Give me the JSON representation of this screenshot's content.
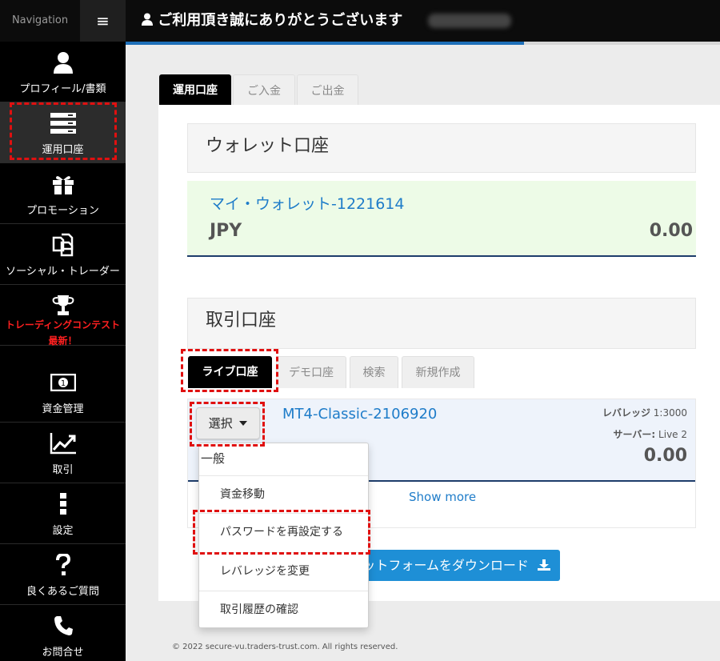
{
  "sidebar": {
    "nav_label": "Navigation",
    "menu_glyph": "≡",
    "items": [
      {
        "label": "プロフィール/書類",
        "icon": "user-icon"
      },
      {
        "label": "運用口座",
        "icon": "server-icon"
      },
      {
        "label": "プロモーション",
        "icon": "gift-icon"
      },
      {
        "label": "ソーシャル・トレーダー",
        "icon": "copy-icon"
      },
      {
        "label": "トレーディングコンテスト",
        "label2": "最新！",
        "icon": "trophy-icon"
      },
      {
        "label": "資金管理",
        "icon": "money-icon"
      },
      {
        "label": "取引",
        "icon": "chart-icon"
      },
      {
        "label": "設定",
        "icon": "vertical-dots-icon"
      },
      {
        "label": "良くあるご質問",
        "icon": "question-icon"
      },
      {
        "label": "お問合せ",
        "icon": "phone-icon"
      }
    ]
  },
  "header": {
    "title": "ご利用頂き誠にありがとうございます",
    "progress": 0.67
  },
  "main_tabs": [
    "運用口座",
    "ご入金",
    "ご出金"
  ],
  "wallet": {
    "title": "ウォレット口座",
    "name": "マイ・ウォレット-1221614",
    "currency": "JPY",
    "balance": "0.00"
  },
  "trading": {
    "title": "取引口座",
    "tabs": [
      "ライブ口座",
      "デモ口座",
      "検索",
      "新規作成"
    ],
    "account_name": "MT4-Classic-2106920",
    "leverage_label": "レバレッジ",
    "leverage_value": "1:3000",
    "server_label": "サーバー:",
    "server_value": "Live 2",
    "balance": "0.00",
    "show_more": "Show more",
    "select_label": "選択",
    "download_label": "ットフォームをダウンロード"
  },
  "dropdown": {
    "header": "一般",
    "items": [
      "資金移動",
      "パスワードを再設定する",
      "レバレッジを変更",
      "取引履歴の確認"
    ]
  },
  "footer": "© 2022 secure-vu.traders-trust.com. All rights reserved.",
  "colors": {
    "accent": "#1e7cc9",
    "highlight": "#e01010",
    "button": "#1e8fd6"
  }
}
